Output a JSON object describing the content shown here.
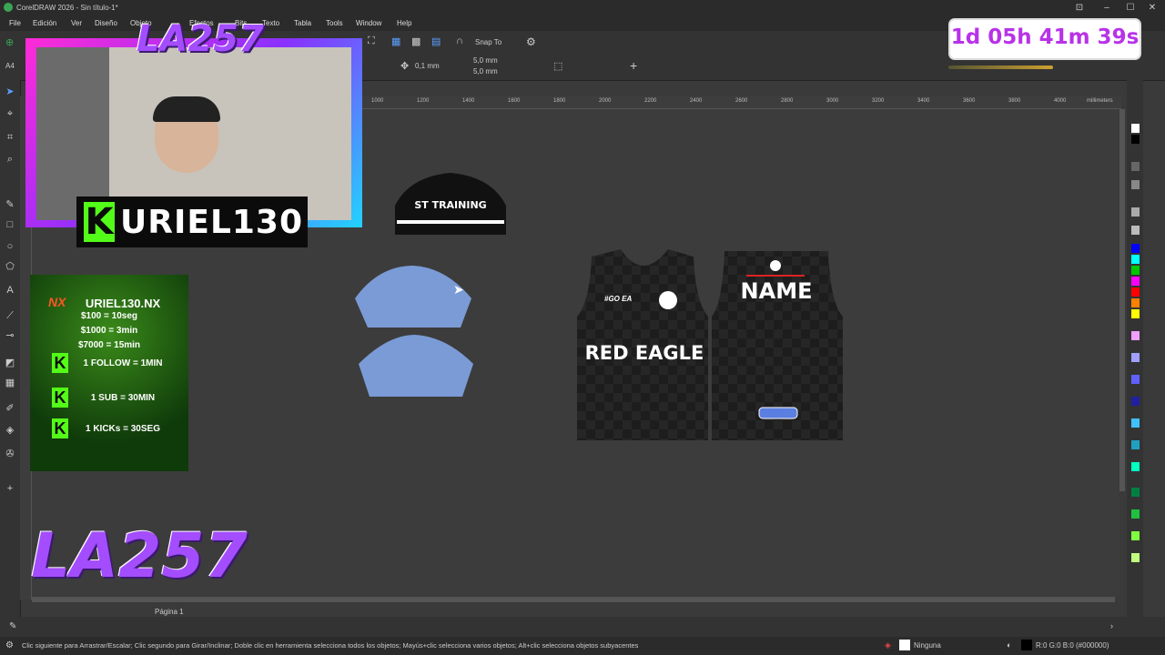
{
  "window": {
    "title": "CorelDRAW 2026 - Sin título-1*"
  },
  "menu": [
    "File",
    "Edición",
    "Ver",
    "Diseño",
    "Objeto",
    "Efectos",
    "Bits",
    "Texto",
    "Tabla",
    "Tools",
    "Window",
    "Help"
  ],
  "toolbar": {
    "snap_label": "Snap To",
    "page_size": "A4",
    "nudge": "0,1 mm",
    "dup_x": "5,0 mm",
    "dup_y": "5,0 mm"
  },
  "ruler": {
    "labels": [
      "1000",
      "1200",
      "1400",
      "1600",
      "1800",
      "2000",
      "2200",
      "2400",
      "2600",
      "2800",
      "3000",
      "3200",
      "3400",
      "3600",
      "3800",
      "4000"
    ],
    "unit": "millimeters"
  },
  "stream": {
    "timer": "1d 05h 41m 39s",
    "streamer": "URIEL130",
    "handle": "URIEL130.NX",
    "donations": [
      "$100 = 10seg",
      "$1000 = 3min",
      "$7000 = 15min"
    ],
    "kick_rules": [
      "1 FOLLOW = 1MIN",
      "1 SUB = 30MIN",
      "1 KICKs = 30SEG"
    ],
    "logo": "LA257"
  },
  "canvas": {
    "shorts_label": "ST TRAINING",
    "jersey_front_brand": "RED EAGLE",
    "jersey_back_name": "NAME",
    "jersey_tag": "#GO EA"
  },
  "page_tab": "Página 1",
  "status": {
    "hint": "Clic siguiente para Arrastrar/Escalar; Clic segundo para Girar/Inclinar; Doble clic en herramienta selecciona todos los objetos; Mayús+clic selecciona varios objetos; Alt+clic selecciona objetos subyacentes",
    "fill": "Ninguna",
    "outline": "R:0 G:0 B:0 (#000000)"
  },
  "colors": {
    "accent_purple": "#b832e8",
    "kick_green": "#53fc18",
    "shape_blue": "#7b9bd6"
  }
}
